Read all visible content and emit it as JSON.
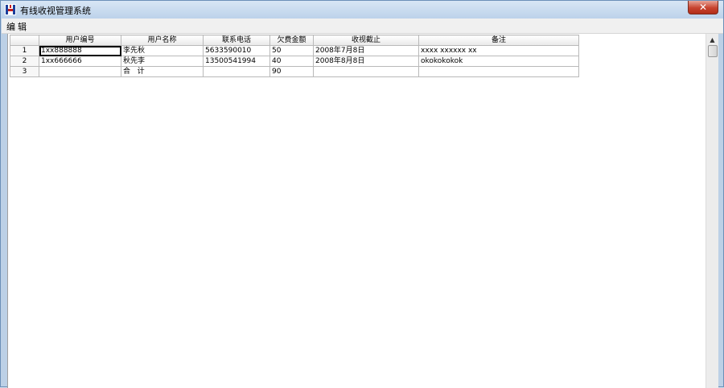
{
  "window": {
    "title": "有线收视管理系统",
    "close_label": "✕"
  },
  "menu": {
    "edit_label": "编辑"
  },
  "table": {
    "columns": [
      "用户编号",
      "用户名称",
      "联系电话",
      "欠费金额",
      "收视截止",
      "备注"
    ],
    "rows": [
      {
        "num": "1",
        "cells": [
          "1xx888888",
          "李先秋",
          "5633590010",
          "50",
          "2008年7月8日",
          "xxxx xxxxxx xx"
        ]
      },
      {
        "num": "2",
        "cells": [
          "1xx666666",
          "秋先李",
          "13500541994",
          "40",
          "2008年8月8日",
          "okokokokok"
        ]
      },
      {
        "num": "3",
        "cells": [
          "",
          "合   计",
          "",
          "90",
          "",
          ""
        ]
      }
    ]
  },
  "icons": {
    "app": "app-logo-icon",
    "scroll_up": "scroll-up-arrow-icon"
  },
  "colors": {
    "title_bar": "#bcd2ea",
    "close_button": "#c7432f",
    "grid_border": "#b9b9b9"
  }
}
